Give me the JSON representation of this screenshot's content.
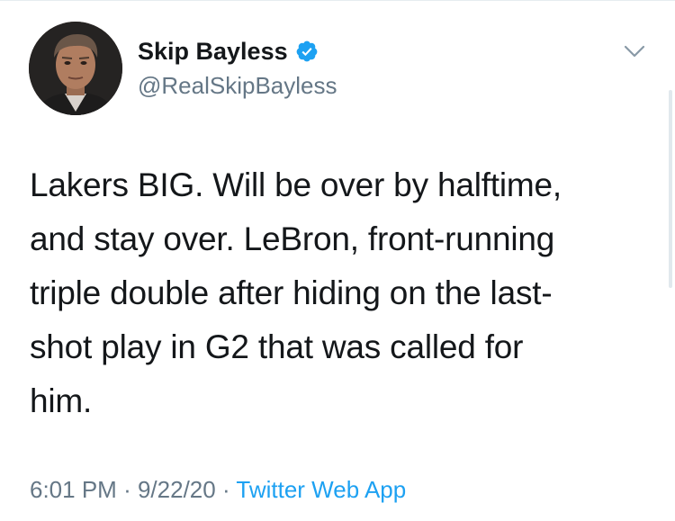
{
  "author": {
    "display_name": "Skip Bayless",
    "handle": "@RealSkipBayless",
    "verified": true,
    "avatar_icon": "profile-photo"
  },
  "tweet": {
    "text": "Lakers BIG. Will be over by halftime,\nand stay over. LeBron, front-running\ntriple double after hiding on the last-\nshot play in G2 that was called for\nhim.",
    "time": "6:01 PM",
    "date": "9/22/20",
    "source": "Twitter Web App",
    "separator": "·"
  },
  "icons": {
    "verified": "verified-badge-icon",
    "menu": "chevron-down-icon"
  },
  "colors": {
    "text": "#14171a",
    "secondary": "#657786",
    "link": "#1da1f2",
    "verified": "#1da1f2"
  }
}
